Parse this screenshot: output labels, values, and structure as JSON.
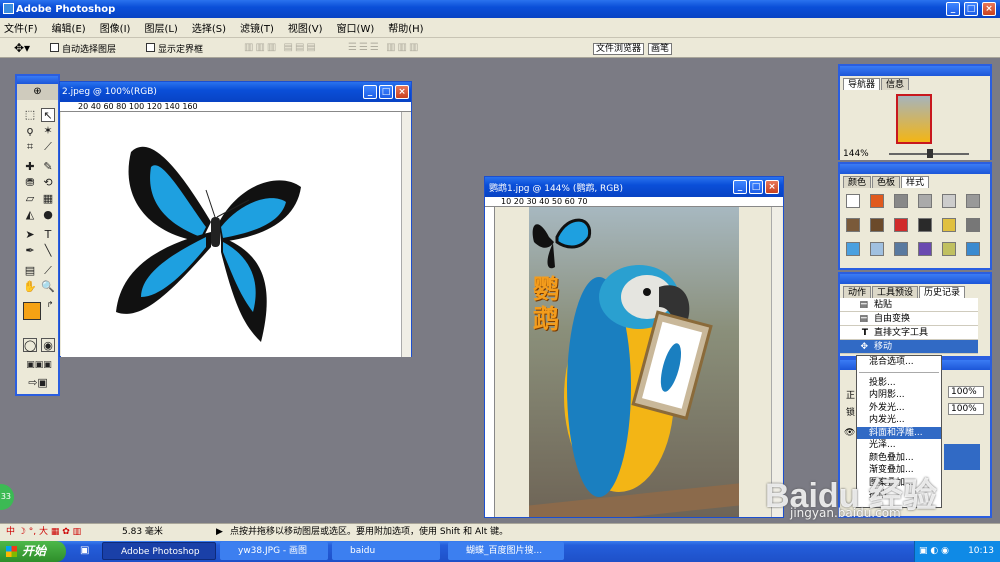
{
  "app": {
    "title": "Adobe Photoshop"
  },
  "menu": [
    "文件(F)",
    "编辑(E)",
    "图像(I)",
    "图层(L)",
    "选择(S)",
    "滤镜(T)",
    "视图(V)",
    "窗口(W)",
    "帮助(H)"
  ],
  "options": {
    "auto_select": "自动选择图层",
    "show_bounds": "显示定界框",
    "palette_tab1": "文件浏览器",
    "palette_tab2": "画笔"
  },
  "doc1": {
    "title": "2.jpeg @ 100%(RGB)",
    "ruler": "20    40    60    80    100    120    140    160"
  },
  "doc2": {
    "title": "鹦鹉1.jpg @ 144% (鹦鹉, RGB)",
    "ruler": "10   20   30   40   50   60   70",
    "image_text": "鹦鹉"
  },
  "navigator": {
    "tab1": "导航器",
    "tab2": "信息",
    "zoom": "144%"
  },
  "color_panel": {
    "tab1": "颜色",
    "tab2": "色板",
    "tab3": "样式"
  },
  "history_panel": {
    "tab1": "动作",
    "tab2": "工具预设",
    "tab3": "历史记录",
    "items": [
      "粘贴",
      "自由变换",
      "直排文字工具",
      "移动"
    ]
  },
  "layers": {
    "opacity_label": "正",
    "opacity": "100%",
    "fill_label": "锁",
    "fill": "100%"
  },
  "context_menu": [
    "混合选项...",
    "投影...",
    "内阴影...",
    "外发光...",
    "内发光...",
    "斜面和浮雕...",
    "光泽...",
    "颜色叠加...",
    "渐变叠加...",
    "图案叠加...",
    "描边..."
  ],
  "status": {
    "size": "5.83 毫米",
    "hint": "点按并拖移以移动图层或选区。要用附加选项，使用 Shift 和 Alt 键。"
  },
  "ime": {
    "label": "中",
    "size": "大"
  },
  "taskbar": {
    "start": "开始",
    "items": [
      "Adobe Photoshop",
      "yw38.JPG - 画图",
      "baidu",
      "蝴蝶_百度图片搜..."
    ],
    "clock": "10:13",
    "badge": "33"
  },
  "watermark": {
    "text": "Baidu 经验",
    "url": "jingyan.baidu.com"
  }
}
